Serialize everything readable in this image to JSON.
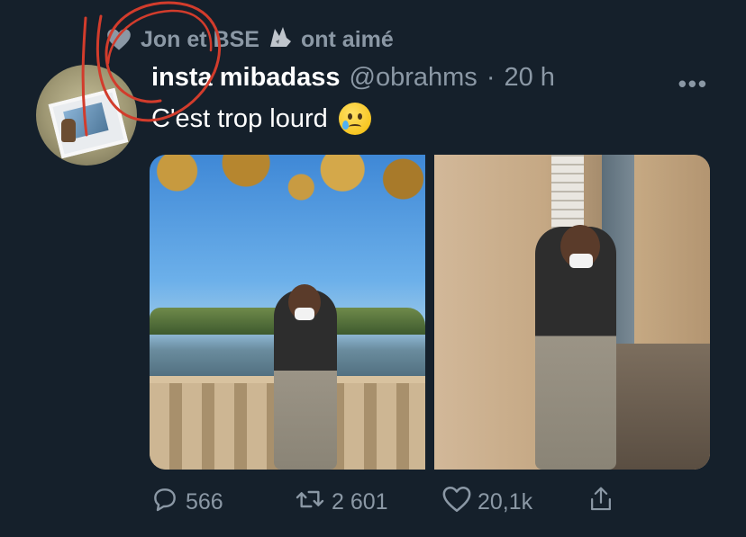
{
  "social_context": {
    "text_a": "Jon et BSE",
    "text_b": "ont aimé"
  },
  "tweet": {
    "name": "insta mibadass",
    "handle": "@obrahms",
    "separator": "·",
    "time": "20 h",
    "text": "C'est trop lourd",
    "more_label": "•••"
  },
  "stats": {
    "replies": "566",
    "retweets": "2 601",
    "likes": "20,1k"
  },
  "icons": {
    "heart": "heart-icon",
    "reply": "reply-icon",
    "retweet": "retweet-icon",
    "like": "like-icon",
    "share": "share-icon",
    "wolf": "wolf-emoji",
    "tear_face": "face-holding-back-tears-emoji"
  },
  "colors": {
    "background": "#15202b",
    "secondary_text": "#8b98a5",
    "annotation": "#d23c2c"
  }
}
